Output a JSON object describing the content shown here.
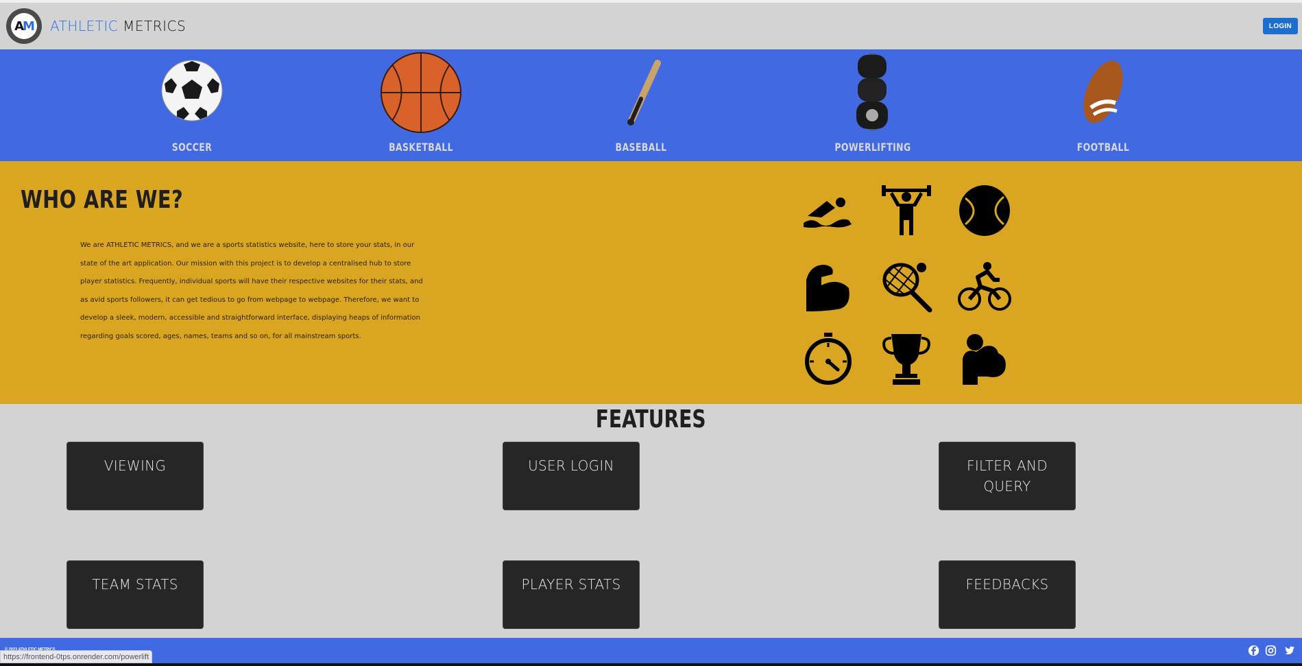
{
  "header": {
    "brand_part1": "ATHLETIC",
    "brand_part2": "METRICS",
    "login_label": "LOGIN"
  },
  "sports": [
    {
      "label": "SOCCER",
      "icon": "soccer-ball-icon"
    },
    {
      "label": "BASKETBALL",
      "icon": "basketball-icon"
    },
    {
      "label": "BASEBALL",
      "icon": "baseball-bat-icon"
    },
    {
      "label": "POWERLIFTING",
      "icon": "dumbbell-icon"
    },
    {
      "label": "FOOTBALL",
      "icon": "football-icon"
    }
  ],
  "about": {
    "title": "WHO ARE WE?",
    "text": "We are ATHLETIC METRICS, and we are a sports statistics website, here to store your stats, in our state of the art application. Our mission with this project is to develop a centralised hub to store player statistics. Frequently, individual sports will have their respective websites for their stats, and as avid sports followers, it can get tedious to go from webpage to webpage. Therefore, we want to develop a sleek, modern, accessible and straightforward interface, displaying heaps of information regarding goals scored, ages, names, teams and so on, for all mainstream sports.",
    "icons": [
      "swimmer-icon",
      "weightlifter-icon",
      "tennis-ball-icon",
      "flexed-arm-icon",
      "tennis-racket-icon",
      "cyclist-icon",
      "stopwatch-icon",
      "trophy-icon",
      "strongman-icon"
    ]
  },
  "features": {
    "title": "FEATURES",
    "cards": [
      "VIEWING",
      "USER LOGIN",
      "FILTER AND QUERY",
      "TEAM STATS",
      "PLAYER STATS",
      "FEEDBACKS"
    ]
  },
  "footer": {
    "copyright": "© 2023 ATHLETIC METRICS",
    "social": [
      "facebook-icon",
      "instagram-icon",
      "twitter-icon"
    ]
  },
  "status_url": "https://frontend-0tps.onrender.com/powerlift",
  "colors": {
    "header_bg": "#d3d3d3",
    "sports_bg": "#4169e1",
    "about_bg": "#daa520",
    "card_bg": "#262626",
    "login_bg": "#1c6fd1"
  }
}
